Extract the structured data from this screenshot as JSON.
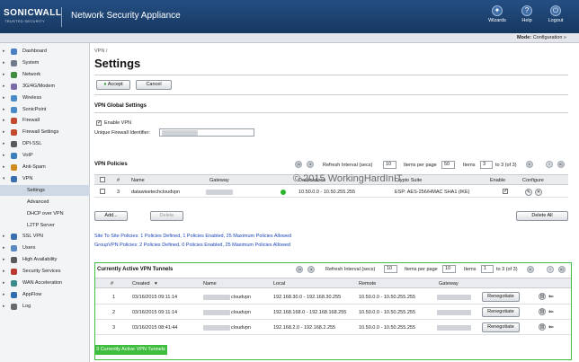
{
  "brand": {
    "logo": "SONICWALL",
    "logo_sub": "TRUSTED SECURITY",
    "app_title": "Network Security Appliance"
  },
  "top_actions": [
    {
      "label": "Wizards",
      "icon": "wizard-icon"
    },
    {
      "label": "Help",
      "icon": "help-icon"
    },
    {
      "label": "Logout",
      "icon": "logout-icon"
    }
  ],
  "mode": {
    "label": "Mode:",
    "value": "Configuration »"
  },
  "sidebar": {
    "items": [
      {
        "label": "Dashboard",
        "arrow": "▸",
        "color": "#4a7fc1"
      },
      {
        "label": "System",
        "arrow": "▸",
        "color": "#6f7b8a"
      },
      {
        "label": "Network",
        "arrow": "▸",
        "color": "#3f8c3f"
      },
      {
        "label": "3G/4G/Modem",
        "arrow": "▸",
        "color": "#7a6aa8"
      },
      {
        "label": "Wireless",
        "arrow": "▸",
        "color": "#4a8ac6"
      },
      {
        "label": "SonicPoint",
        "arrow": "▸",
        "color": "#4a8ac6"
      },
      {
        "label": "Firewall",
        "arrow": "▸",
        "color": "#c24a2e"
      },
      {
        "label": "Firewall Settings",
        "arrow": "▸",
        "color": "#c24a2e"
      },
      {
        "label": "DPI-SSL",
        "arrow": "▸",
        "color": "#5a5a5a"
      },
      {
        "label": "VoIP",
        "arrow": "▸",
        "color": "#3a7fba"
      },
      {
        "label": "Anti-Spam",
        "arrow": "▸",
        "color": "#d08a1e"
      },
      {
        "label": "VPN",
        "arrow": "▾",
        "color": "#3a6fb0"
      },
      {
        "label": "Settings",
        "arrow": "",
        "color": ""
      },
      {
        "label": "Advanced",
        "arrow": "",
        "color": ""
      },
      {
        "label": "DHCP over VPN",
        "arrow": "",
        "color": ""
      },
      {
        "label": "L2TP Server",
        "arrow": "",
        "color": ""
      },
      {
        "label": "SSL VPN",
        "arrow": "▸",
        "color": "#3a6fb0"
      },
      {
        "label": "Users",
        "arrow": "▸",
        "color": "#5a8ac0"
      },
      {
        "label": "High Availability",
        "arrow": "▸",
        "color": "#5a5a5a"
      },
      {
        "label": "Security Services",
        "arrow": "▸",
        "color": "#b83a2e"
      },
      {
        "label": "WAN Acceleration",
        "arrow": "▸",
        "color": "#3a8a8a"
      },
      {
        "label": "AppFlow",
        "arrow": "▸",
        "color": "#2e6fb0"
      },
      {
        "label": "Log",
        "arrow": "▸",
        "color": "#6a6a6a"
      }
    ]
  },
  "page": {
    "breadcrumb": "VPN /",
    "title": "Settings",
    "accept": "Accept",
    "cancel": "Cancel"
  },
  "global": {
    "title": "VPN Global Settings",
    "enable_label": "Enable VPN",
    "uid_label": "Unique Firewall Identifier:"
  },
  "policies": {
    "title": "VPN Policies",
    "refresh_label": "Refresh Interval (secs)",
    "refresh_value": "10",
    "ipp_label": "Items per page",
    "ipp_value": "50",
    "items_label": "Items",
    "items_value": "3",
    "items_range": "to 3 (of 3)",
    "headers": [
      "#",
      "Name",
      "Gateway",
      "Destinations",
      "Crypto Suite",
      "Enable",
      "Configure"
    ],
    "rows": [
      {
        "num": "3",
        "name": "datawisetechcloudvpn",
        "dest": "10.50.0.0 - 10.50.255.255",
        "crypto": "ESP: AES-256/HMAC SHA1 (IKE)"
      }
    ],
    "add": "Add...",
    "delete": "Delete",
    "delete_all": "Delete All"
  },
  "info": {
    "site": "Site To Site Policies: 1 Policies Defined, 1 Policies Enabled, 25 Maximum Policies Allowed",
    "group": "GroupVPN Policies: 2 Policies Defined, 0 Policies Enabled, 25 Maximum Policies Allowed"
  },
  "tunnels": {
    "title": "Currently Active VPN Tunnels",
    "refresh_label": "Refresh Interval (secs)",
    "refresh_value": "10",
    "ipp_label": "Items per page",
    "ipp_value": "10",
    "items_label": "Items",
    "items_value": "1",
    "items_range": "to 3 (of 3)",
    "headers": [
      "#",
      "Created",
      "Name",
      "Local",
      "Remote",
      "Gateway"
    ],
    "renegotiate": "Renegotiate",
    "rows": [
      {
        "num": "1",
        "created": "03/16/2015 09:11:14",
        "name": "cloudvpn",
        "local": "192.168.30.0 - 192.168.30.255",
        "remote": "10.50.0.0 - 10.50.255.255"
      },
      {
        "num": "2",
        "created": "03/16/2015 09:11:14",
        "name": "cloudvpn",
        "local": "192.168.168.0 - 192.168.168.255",
        "remote": "10.50.0.0 - 10.50.255.255"
      },
      {
        "num": "3",
        "created": "03/16/2015 08:41:44",
        "name": "cloudvpn",
        "local": "192.168.2.0 - 192.168.2.255",
        "remote": "10.50.0.0 - 10.50.255.255"
      }
    ],
    "status": "3 Currently Active VPN Tunnels"
  },
  "watermark": "© 2015 WorkingHardInIT"
}
